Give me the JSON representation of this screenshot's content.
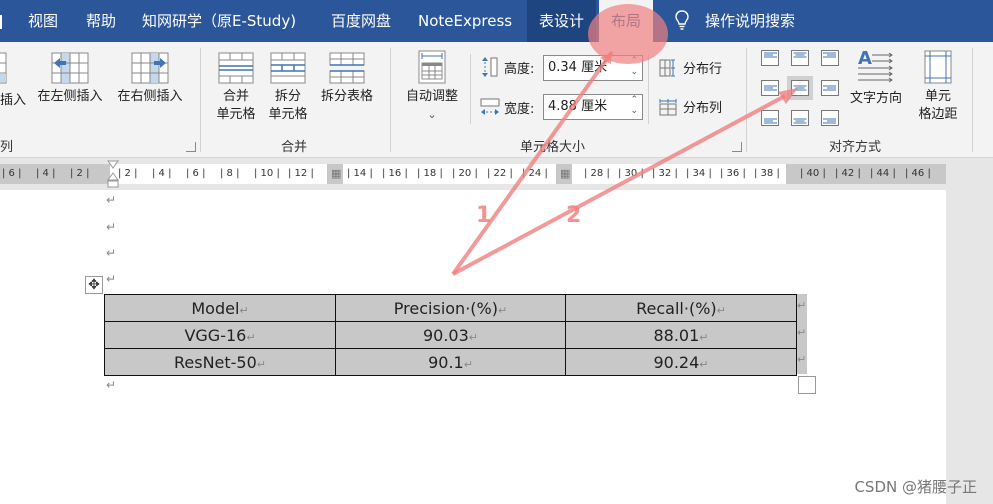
{
  "tabs": {
    "items": [
      {
        "label": "视图"
      },
      {
        "label": "帮助"
      },
      {
        "label": "知网研学（原E-Study)"
      },
      {
        "label": "百度网盘"
      },
      {
        "label": "NoteExpress"
      },
      {
        "label": "表设计"
      },
      {
        "label": "布局"
      }
    ],
    "selected": "布局",
    "search_label": "操作说明搜索"
  },
  "ribbon": {
    "rows_cols": {
      "insert_partial_label": "插入",
      "insert_left_label": "在左侧插入",
      "insert_right_label": "在右侧插入",
      "group_label_partial": "列"
    },
    "merge": {
      "merge_cells_label_1": "合并",
      "merge_cells_label_2": "单元格",
      "split_cells_label_1": "拆分",
      "split_cells_label_2": "单元格",
      "split_table_label": "拆分表格",
      "group_label": "合并"
    },
    "cell_size": {
      "autofit_label": "自动调整",
      "autofit_caret": "⌄",
      "height_label": "高度:",
      "height_value": "0.34 厘米",
      "width_label": "宽度:",
      "width_value": "4.88 厘米",
      "distribute_rows_label": "分布行",
      "distribute_cols_label": "分布列",
      "group_label": "单元格大小"
    },
    "alignment": {
      "text_direction_label": "文字方向",
      "cell_margins_label_1": "单元",
      "cell_margins_label_2": "格边距",
      "group_label": "对齐方式",
      "selected_alignment": "center-middle"
    }
  },
  "ruler": {
    "left_marks": [
      "6",
      "4",
      "2"
    ],
    "marks_a": [
      "2",
      "4",
      "6",
      "8",
      "10",
      "12"
    ],
    "marks_b": [
      "14",
      "16",
      "18",
      "20",
      "22",
      "24"
    ],
    "marks_c": [
      "28",
      "30",
      "32",
      "34",
      "36",
      "38"
    ],
    "marks_d": [
      "40",
      "42",
      "44",
      "46"
    ]
  },
  "document": {
    "paragraph_mark": "↵",
    "table": {
      "headers": [
        "Model",
        "Precision·(%)",
        "Recall·(%)"
      ],
      "rows": [
        [
          "VGG-16",
          "90.03",
          "88.01"
        ],
        [
          "ResNet-50",
          "90.1",
          "90.24"
        ]
      ]
    }
  },
  "annotations": {
    "step1": "1",
    "step2": "2",
    "color": "#f08080"
  },
  "watermark": "CSDN @猪腰子正",
  "colors": {
    "tab_bar": "#2b579a",
    "ribbon_bg": "#f3f3f3",
    "cell_shading": "#c8c8c8",
    "icon_blue": "#4a7ebb"
  }
}
